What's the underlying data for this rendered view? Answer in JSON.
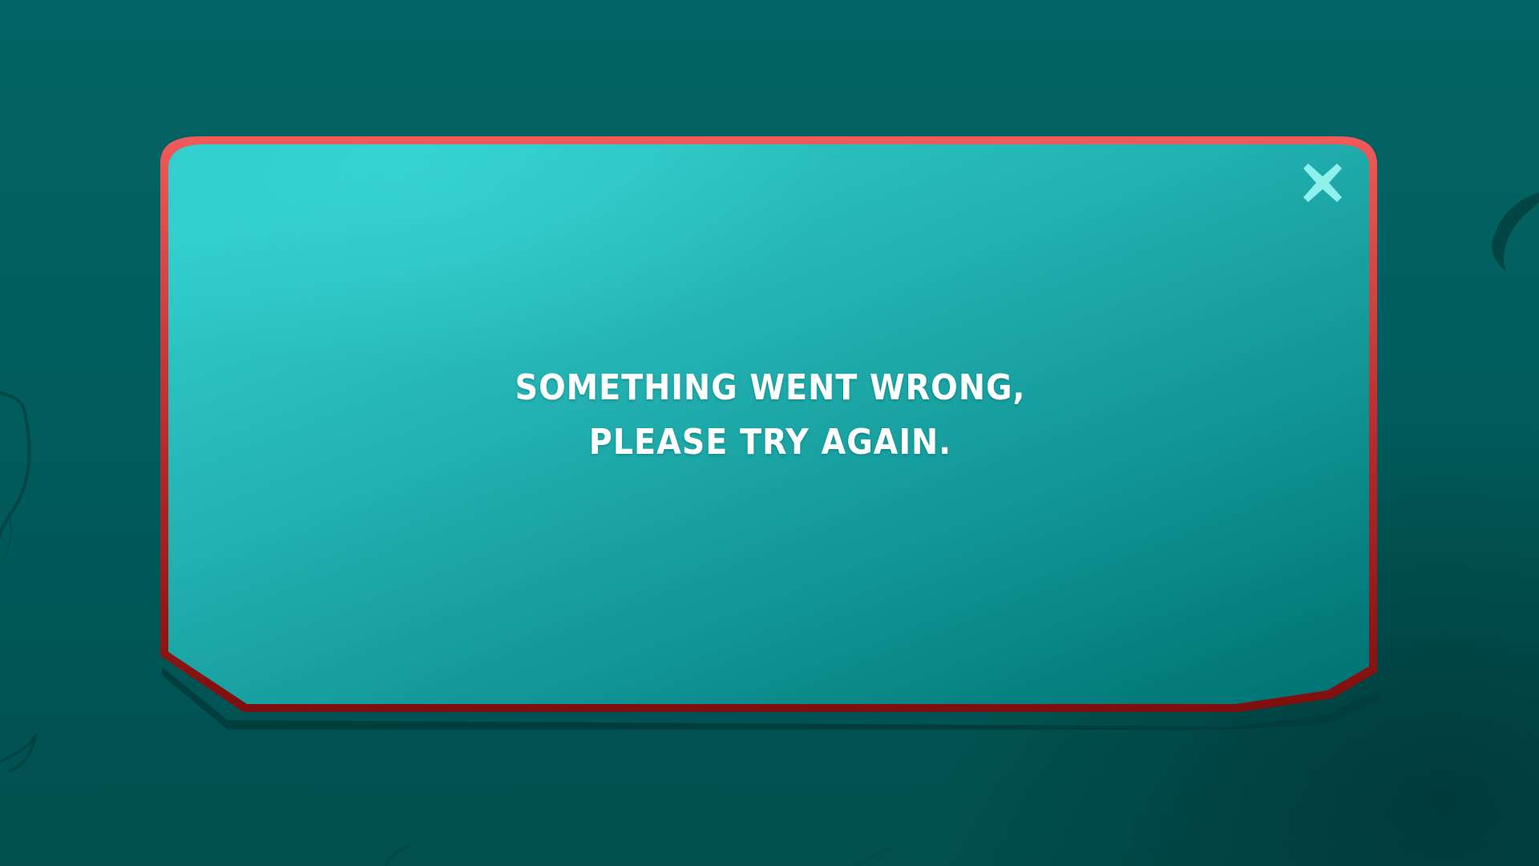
{
  "dialog": {
    "message_line_1": "SOMETHING WENT WRONG,",
    "message_line_2": "PLEASE TRY AGAIN.",
    "close_icon": "close-x-icon"
  },
  "colors": {
    "background": "#026464",
    "panel_light": "#31cccc",
    "panel_dark": "#017676",
    "border_top": "#ef5a5a",
    "border_bottom": "#7e0e0e",
    "close_icon": "#8ff0ec",
    "text": "#ffffff"
  }
}
